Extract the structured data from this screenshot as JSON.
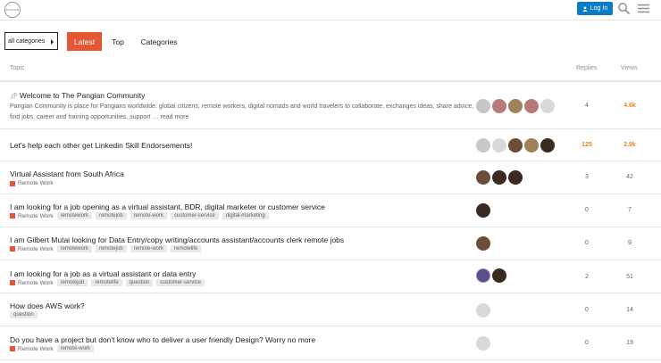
{
  "header": {
    "logo_text": "PANGIAN",
    "login_label": "Log In",
    "icons": [
      "user-icon",
      "search-icon",
      "hamburger-menu-icon"
    ],
    "accent_color": "#0a7cc4"
  },
  "nav": {
    "category_select": "all categories",
    "tabs": [
      {
        "label": "Latest",
        "active": true
      },
      {
        "label": "Top",
        "active": false
      },
      {
        "label": "Categories",
        "active": false
      }
    ],
    "active_color": "#e45735"
  },
  "table": {
    "headers": {
      "topic": "Topic",
      "replies": "Replies",
      "views": "Views"
    },
    "rows": [
      {
        "pinned": true,
        "title": "Welcome to The Pangian Community",
        "excerpt": "Pangian Community is place for Pangians worldwide: global citizens, remote workers, digital nomads and world travelers to collaborate, exchanges ideas, share advice, find jobs, career and training opportunities, support … read more",
        "replies": "4",
        "views": "4.6k",
        "views_hot": true
      },
      {
        "title": "Let's help each other get Linkedin Skill Endorsements!",
        "replies": "125",
        "views": "2.9k",
        "views_hot": true,
        "replies_hot": true
      },
      {
        "title": "Virtual Assistant from South Africa",
        "category": "Remote Work",
        "replies": "3",
        "views": "42"
      },
      {
        "title": "I am looking for a job opening as a virtual assistant, BDR, digital marketer or customer service",
        "category": "Remote Work",
        "tags": [
          "remotework",
          "remotejob",
          "remote-work",
          "customer-service",
          "digital-marketing"
        ],
        "replies": "0",
        "views": "7"
      },
      {
        "title": "I am Gilbert Mutai looking for Data Entry/copy writing/accounts assistant/accounts clerk remote jobs",
        "category": "Remote Work",
        "tags": [
          "remotework",
          "remotejob",
          "remote-work",
          "remotelife"
        ],
        "replies": "0",
        "views": "9"
      },
      {
        "title": "I am looking for a job as a virtual assistant or data entry",
        "category": "Remote Work",
        "tags": [
          "remotejob",
          "remotelife",
          "question",
          "customer-service"
        ],
        "replies": "2",
        "views": "51"
      },
      {
        "title": "How does AWS work?",
        "tags": [
          "question"
        ],
        "replies": "0",
        "views": "14"
      },
      {
        "title": "Do you have a project but don't know who to deliver a user friendly Design? Worry no more",
        "category": "Remote Work",
        "tags": [
          "remote-work"
        ],
        "replies": "0",
        "views": "19"
      }
    ]
  }
}
